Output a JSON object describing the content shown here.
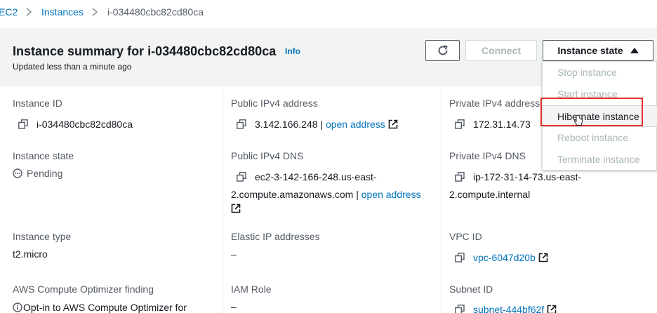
{
  "breadcrumb": {
    "items": [
      "EC2",
      "Instances",
      "i-034480cbc82cd80ca"
    ]
  },
  "summary": {
    "title": "Instance summary for i-034480cbc82cd80ca",
    "info_label": "Info",
    "updated": "Updated less than a minute ago"
  },
  "toolbar": {
    "connect_label": "Connect",
    "instance_state_label": "Instance state"
  },
  "instance_state_menu": {
    "items": [
      "Stop instance",
      "Start instance",
      "Hibernate instance",
      "Reboot instance",
      "Terminate instance"
    ],
    "enabled_item": "Hibernate instance"
  },
  "details": {
    "instance_id": {
      "label": "Instance ID",
      "value": "i-034480cbc82cd80ca"
    },
    "public_ipv4": {
      "label": "Public IPv4 address",
      "value": "3.142.166.248 |",
      "link": "open address"
    },
    "private_ipv4": {
      "label": "Private IPv4 addresses",
      "value": "172.31.14.73"
    },
    "instance_state": {
      "label": "Instance state",
      "value": "Pending"
    },
    "public_dns": {
      "label": "Public IPv4 DNS",
      "value_line1": "ec2-3-142-166-248.us-east-",
      "value_line2": "2.compute.amazonaws.com |",
      "link": "open address"
    },
    "private_dns": {
      "label": "Private IPv4 DNS",
      "value_line1": "ip-172-31-14-73.us-east-",
      "value_line2": "2.compute.internal"
    },
    "instance_type": {
      "label": "Instance type",
      "value": "t2.micro"
    },
    "elastic_ip": {
      "label": "Elastic IP addresses",
      "value": "–"
    },
    "vpc_id": {
      "label": "VPC ID",
      "value": "vpc-6047d20b"
    },
    "optimizer": {
      "label": "AWS Compute Optimizer finding",
      "value": "Opt-in to AWS Compute Optimizer for"
    },
    "iam_role": {
      "label": "IAM Role",
      "value": "–"
    },
    "subnet_id": {
      "label": "Subnet ID",
      "value": "subnet-444bf62f"
    }
  },
  "colors": {
    "link": "#0073bb",
    "highlight_box": "#e8302a",
    "header_bg": "#f2f3f3",
    "disabled_text": "#aab7b8"
  }
}
